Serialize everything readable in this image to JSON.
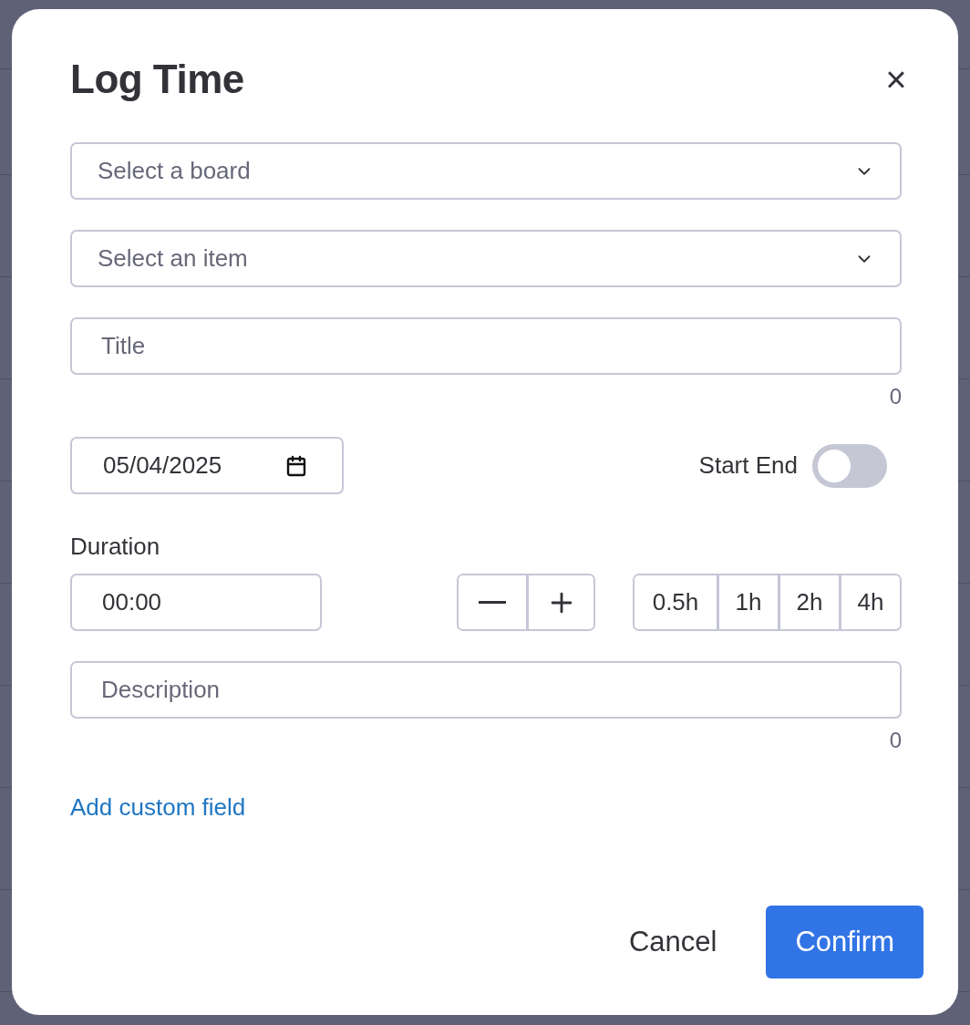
{
  "dialog": {
    "title": "Log Time",
    "close": "×"
  },
  "board_select": {
    "placeholder": "Select a board"
  },
  "item_select": {
    "placeholder": "Select an item"
  },
  "title_field": {
    "placeholder": "Title",
    "counter": "0"
  },
  "date_field": {
    "value": "05/04/2025"
  },
  "start_end_toggle": {
    "label": "Start End",
    "on": false
  },
  "duration": {
    "label": "Duration",
    "value": "00:00"
  },
  "presets": [
    "0.5h",
    "1h",
    "2h",
    "4h"
  ],
  "description_field": {
    "placeholder": "Description",
    "counter": "0"
  },
  "add_custom_field": "Add custom field",
  "buttons": [
    {
      "label": "Cancel",
      "kind": "secondary"
    },
    {
      "label": "Confirm",
      "kind": "primary"
    }
  ]
}
